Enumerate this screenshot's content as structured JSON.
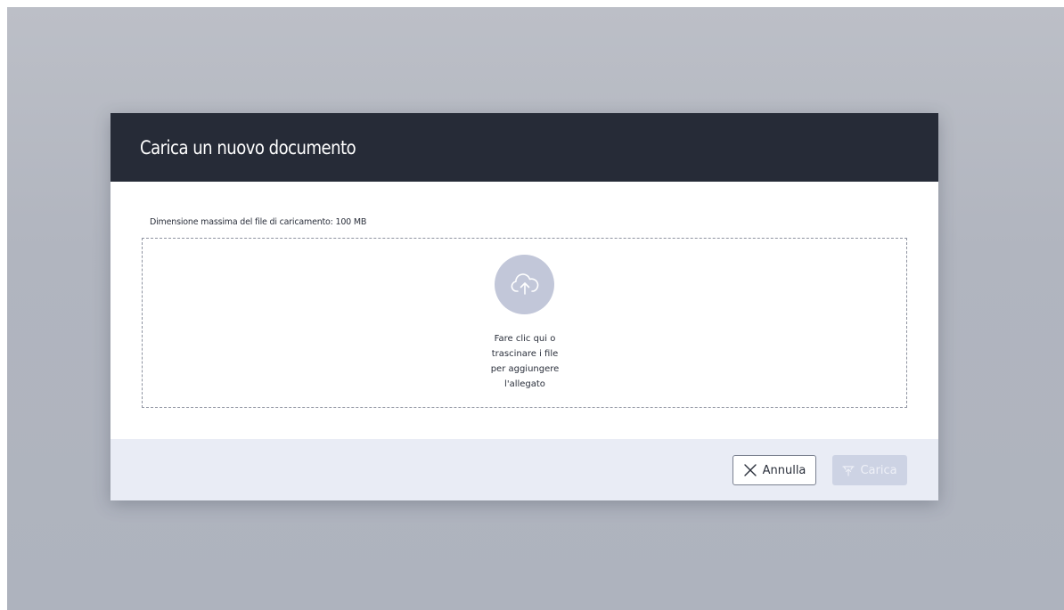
{
  "modal": {
    "title": "Carica un nuovo documento",
    "max_size_note": "Dimensione massima del file di caricamento: 100 MB",
    "dropzone": {
      "icon": "cloud-upload-icon",
      "lines": [
        "Fare clic qui o",
        "trascinare i file",
        "per aggiungere",
        "l'allegato"
      ]
    },
    "footer": {
      "cancel_label": "Annulla",
      "cancel_icon": "close-icon",
      "upload_label": "Carica",
      "upload_icon": "upload-icon",
      "upload_disabled": true
    }
  },
  "colors": {
    "header_bg": "#262b37",
    "footer_bg": "#e9ecf5",
    "upload_circle": "#c2c7d9",
    "upload_button_disabled": "#cdd3e4"
  }
}
